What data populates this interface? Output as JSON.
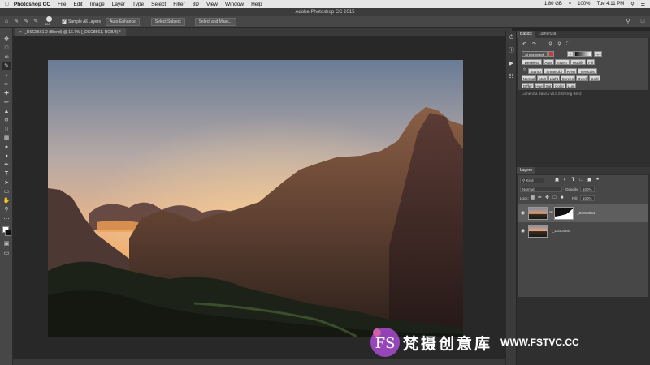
{
  "menubar": {
    "app_name": "Photoshop CC",
    "items": [
      "File",
      "Edit",
      "Image",
      "Layer",
      "Type",
      "Select",
      "Filter",
      "3D",
      "View",
      "Window",
      "Help"
    ],
    "status": {
      "disk": "1.80 GB",
      "battery": "100%",
      "clock": "Tue 4:11 PM"
    }
  },
  "window": {
    "title": "Adobe Photoshop CC 2015"
  },
  "options": {
    "brush_size": "400",
    "sample_all_layers": "Sample All Layers",
    "auto_enhance": "Auto-Enhance",
    "select_subject": "Select Subject",
    "select_and_mask": "Select and Mask..."
  },
  "document": {
    "tab_label": "_DSC8561-2 (Blend) @ 16.7% (_DSC8561, RGB/8) *"
  },
  "lumenzia": {
    "tabs": [
      "Basics",
      "Lumenzia"
    ],
    "show_mask": "Show Mask",
    "plus_label": "+++",
    "buttons_row1": [
      "Deselect",
      "Ants",
      "Invert",
      "Modify",
      "Fill"
    ],
    "buttons_row2": [
      "Stamp",
      "SmartObj",
      "RAW",
      "Verticals"
    ],
    "buttons_row3": [
      "Normal",
      "Mult",
      "Light",
      "Screen",
      "Overl",
      "Softl"
    ],
    "buttons_row4": [
      "Differ",
      "Hue",
      "Sat",
      "Color",
      "Lum"
    ],
    "version": "Lumenzia Basics v6.0.0 GGreg Benz"
  },
  "layers": {
    "tab": "Layers",
    "filter_kind": "Kind",
    "blend_mode": "Normal",
    "opacity_label": "Opacity:",
    "opacity_value": "100%",
    "lock_label": "Lock:",
    "fill_label": "Fill:",
    "fill_value": "100%",
    "items": [
      {
        "name": "_DSC8561",
        "selected": true,
        "has_mask": true
      },
      {
        "name": "_DSC8564",
        "selected": false,
        "has_mask": false
      }
    ]
  },
  "watermark": {
    "text": "梵摄创意库",
    "url": "WWW.FSTVC.CC",
    "logo": "FS"
  }
}
